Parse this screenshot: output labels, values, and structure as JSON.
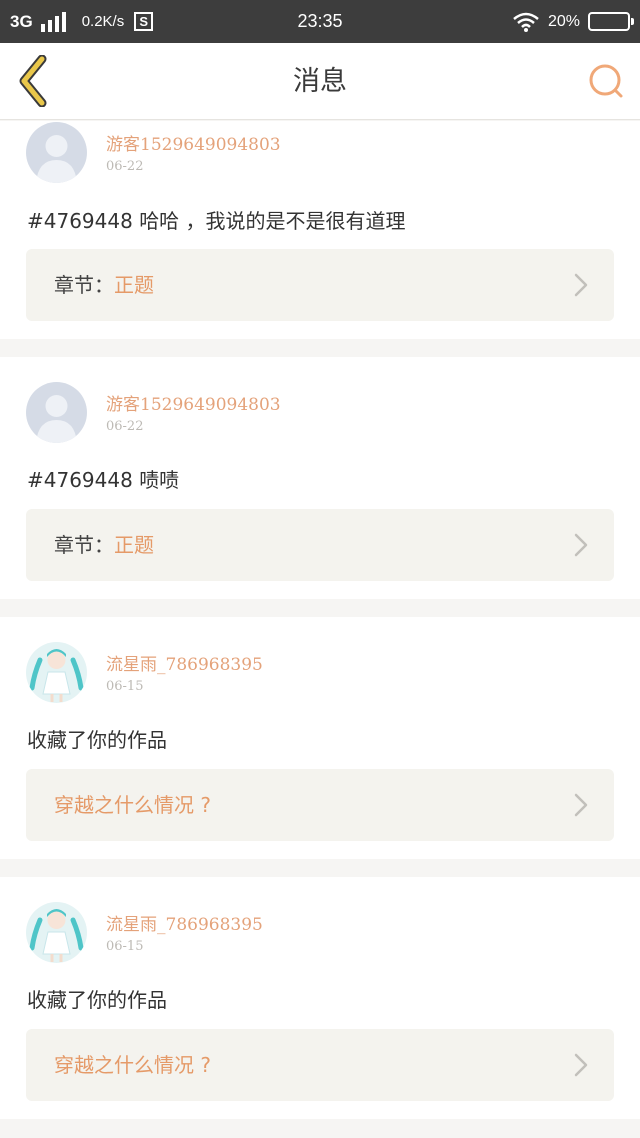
{
  "status_bar": {
    "network": "3G",
    "speed": "0.2K/s",
    "sim_icon": "S",
    "time": "23:35",
    "battery": "20%"
  },
  "header": {
    "title": "消息"
  },
  "messages": [
    {
      "username": "游客1529649094803",
      "date": "06-22",
      "text": "#4769448 哈哈 ，我说的是不是很有道理",
      "chapter_label": "章节：",
      "chapter_value": "正题",
      "avatar": "default"
    },
    {
      "username": "游客1529649094803",
      "date": "06-22",
      "text": "#4769448 啧啧",
      "chapter_label": "章节：",
      "chapter_value": "正题",
      "avatar": "default"
    },
    {
      "username": "流星雨_786968395",
      "date": "06-15",
      "text": "收藏了你的作品",
      "work_title": "穿越之什么情况 ?",
      "avatar": "anime"
    },
    {
      "username": "流星雨_786968395",
      "date": "06-15",
      "text": "收藏了你的作品",
      "work_title": "穿越之什么情况 ?",
      "avatar": "anime"
    }
  ],
  "colors": {
    "accent": "#e59a68",
    "back_icon": "#e9c74a",
    "search_icon": "#f0a878"
  }
}
